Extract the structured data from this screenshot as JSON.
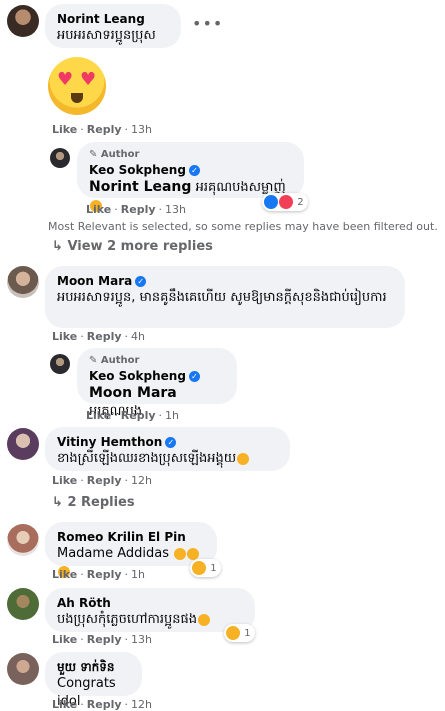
{
  "comments": {
    "c1": {
      "name": "Norint Leang",
      "text": "អបអរសាទរប្អូនប្រុស",
      "like": "Like",
      "reply": "Reply",
      "time": "13h",
      "reply1": {
        "author_tag": "Author",
        "name": "Keo Sokpheng",
        "mention": "Norint Leang",
        "text": "អរគុណបងសម្លាញ់",
        "like": "Like",
        "reply": "Reply",
        "time": "13h",
        "reaction_count": "2"
      },
      "filter_note": "Most Relevant is selected, so some replies may have been filtered out.",
      "view_more": "View 2 more replies"
    },
    "c2": {
      "name": "Moon Mara",
      "text": "អបអរសាទរប្អូន, មានគូនឹងគេហើយ សូមឱ្យមានក្ដីសុខនិងជាប់រៀបការ",
      "like": "Like",
      "reply": "Reply",
      "time": "4h",
      "reply1": {
        "author_tag": "Author",
        "name": "Keo Sokpheng",
        "mention": "Moon Mara",
        "text": "អរគុណបង",
        "like": "Like",
        "reply": "Reply",
        "time": "1h"
      }
    },
    "c3": {
      "name": "Vitiny Hemthon",
      "text": "ខាងស្រីឡើងឈរខាងប្រុសឡើងអង្គុយ",
      "like": "Like",
      "reply": "Reply",
      "time": "12h",
      "replies_link": "2 Replies"
    },
    "c4": {
      "name": "Romeo Krilin El Pin",
      "text": "Madame Addidas",
      "like": "Like",
      "reply": "Reply",
      "time": "1h",
      "reaction_count": "1"
    },
    "c5": {
      "name": "Ah Röth",
      "text": "បងប្រុសកុំភ្លេចហៅការប្អូនផង",
      "like": "Like",
      "reply": "Reply",
      "time": "13h",
      "reaction_count": "1"
    },
    "c6": {
      "name": "មួយ ទាក់ទិន",
      "text": "Congrats idol",
      "like": "Like",
      "reply": "Reply",
      "time": "12h"
    }
  },
  "icons": {
    "verified": "verified-badge-icon",
    "pencil": "pencil-icon",
    "more": "more-options-icon",
    "reply_arrow": "reply-arrow-icon"
  },
  "colors": {
    "bubble": "#f0f2f5",
    "meta": "#65676b",
    "verified": "#1877f2"
  }
}
